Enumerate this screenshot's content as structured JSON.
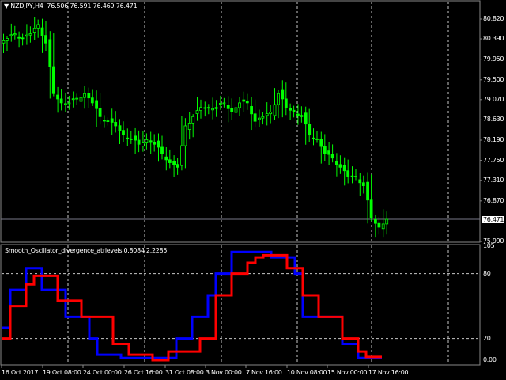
{
  "header": {
    "symbol": "NZDJPY,H4",
    "ohlc": "76.506 76.591 76.469 76.471"
  },
  "price_axis": {
    "labels": [
      "80.820",
      "80.390",
      "79.950",
      "79.500",
      "79.070",
      "78.630",
      "78.190",
      "77.750",
      "77.310",
      "76.870",
      "75.990"
    ],
    "current": "76.471"
  },
  "oscillator": {
    "title": "Smooth_Oscillator_divergence_atrlevels 0.8084 2.2285",
    "axis_labels": [
      "105",
      "80",
      "20",
      "0.00"
    ],
    "levels": [
      80,
      20
    ]
  },
  "time_axis": [
    "16 Oct 2017",
    "19 Oct 08:00",
    "24 Oct 00:00",
    "26 Oct 16:00",
    "31 Oct 08:00",
    "3 Nov 00:00",
    "7 Nov 16:00",
    "10 Nov 08:00",
    "15 Nov 00:00",
    "17 Nov 16:00"
  ],
  "colors": {
    "candle": "#00ff00",
    "grid": "#c8c8c8",
    "blue": "#0000ff",
    "red": "#ff0000"
  },
  "chart_data": [
    {
      "type": "candlestick",
      "series": [
        {
          "name": "NZDJPY,H4",
          "close": [
            80.4,
            80.5,
            80.4,
            80.5,
            80.7,
            80.3,
            79.2,
            79.0,
            79.0,
            79.1,
            79.2,
            79.0,
            78.7,
            78.6,
            78.5,
            78.3,
            78.2,
            78.1,
            78.2,
            78.1,
            77.9,
            77.7,
            77.6,
            78.5,
            78.7,
            78.9,
            78.9,
            78.9,
            79.0,
            78.8,
            79.0,
            79.0,
            78.6,
            78.7,
            78.8,
            79.2,
            78.9,
            78.8,
            78.7,
            78.3,
            78.2,
            77.9,
            77.8,
            77.6,
            77.4,
            77.4,
            77.2,
            76.5,
            76.3,
            76.471
          ]
        }
      ],
      "ylim": [
        75.99,
        80.82
      ]
    },
    {
      "type": "line",
      "ylim": [
        0,
        105
      ],
      "series": [
        {
          "color": "#0000ff",
          "values": [
            30,
            65,
            65,
            85,
            85,
            65,
            65,
            65,
            40,
            40,
            40,
            20,
            5,
            5,
            5,
            2,
            2,
            2,
            2,
            2,
            2,
            2,
            20,
            20,
            40,
            40,
            60,
            80,
            80,
            100,
            100,
            100,
            100,
            100,
            95,
            95,
            95,
            80,
            40,
            40,
            40,
            40,
            40,
            15,
            15,
            2,
            2,
            2
          ]
        },
        {
          "color": "#ff0000",
          "values": [
            20,
            50,
            50,
            70,
            78,
            78,
            78,
            55,
            55,
            55,
            40,
            40,
            40,
            40,
            15,
            15,
            5,
            5,
            5,
            0,
            0,
            8,
            8,
            8,
            8,
            20,
            20,
            60,
            60,
            80,
            80,
            90,
            95,
            97,
            97,
            97,
            85,
            85,
            60,
            60,
            40,
            40,
            40,
            20,
            20,
            8,
            3,
            3
          ]
        }
      ]
    }
  ]
}
